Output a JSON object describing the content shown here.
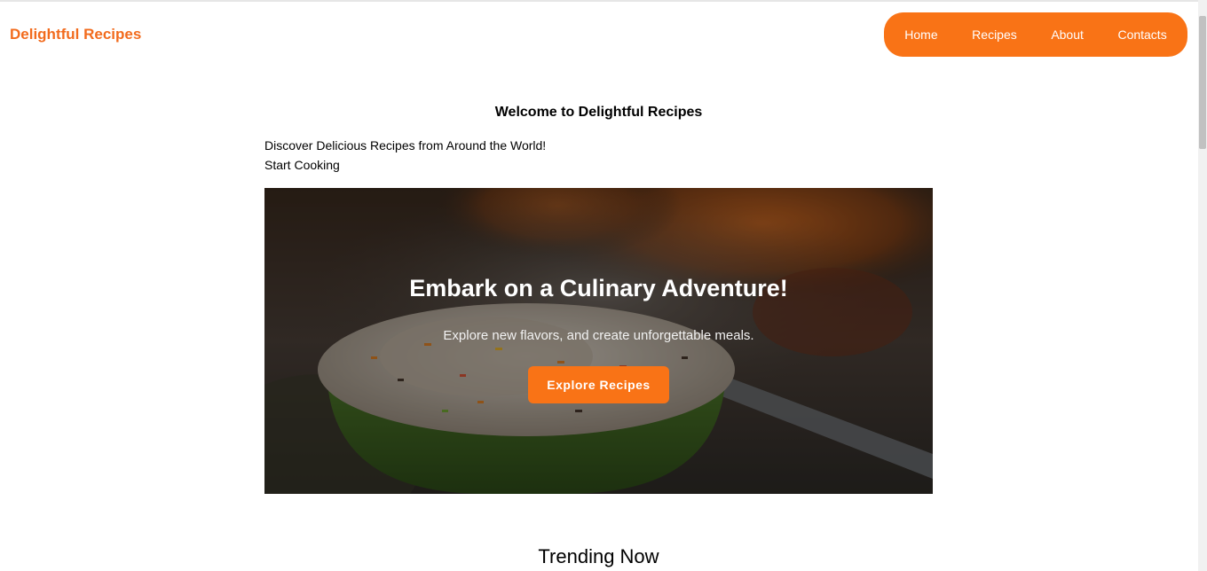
{
  "header": {
    "brand": "Delightful Recipes",
    "nav": [
      "Home",
      "Recipes",
      "About",
      "Contacts"
    ]
  },
  "intro": {
    "welcome": "Welcome to Delightful Recipes",
    "tagline": "Discover Delicious Recipes from Around the World!",
    "cta_text": "Start Cooking"
  },
  "hero": {
    "title": "Embark on a Culinary Adventure!",
    "subtitle": "Explore new flavors, and create unforgettable meals.",
    "button_label": "Explore Recipes"
  },
  "sections": {
    "trending_title": "Trending Now"
  },
  "colors": {
    "accent": "#f97316",
    "brand": "#f26b1d"
  }
}
